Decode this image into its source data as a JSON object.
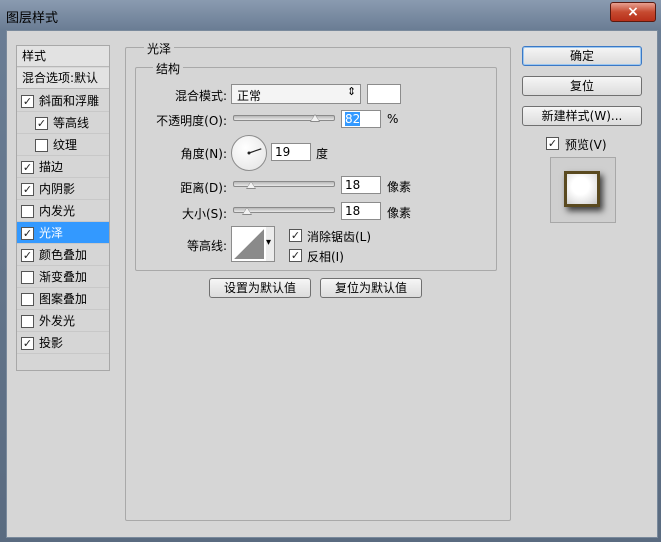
{
  "window": {
    "title": "图层样式",
    "close_glyph": "×"
  },
  "left_panel": {
    "header_styles": "样式",
    "header_blend": "混合选项:默认",
    "items": [
      {
        "label": "斜面和浮雕",
        "checked": true
      },
      {
        "label": "等高线",
        "checked": true
      },
      {
        "label": "纹理",
        "checked": false
      },
      {
        "label": "描边",
        "checked": true
      },
      {
        "label": "内阴影",
        "checked": true
      },
      {
        "label": "内发光",
        "checked": false
      },
      {
        "label": "光泽",
        "checked": true,
        "selected": true
      },
      {
        "label": "颜色叠加",
        "checked": true
      },
      {
        "label": "渐变叠加",
        "checked": false
      },
      {
        "label": "图案叠加",
        "checked": false
      },
      {
        "label": "外发光",
        "checked": false
      },
      {
        "label": "投影",
        "checked": true
      }
    ]
  },
  "main": {
    "section_title": "光泽",
    "group_title": "结构",
    "blend_mode_label": "混合模式:",
    "blend_mode_value": "正常",
    "blend_color": "#ffffff",
    "opacity_label": "不透明度(O):",
    "opacity_value": "82",
    "opacity_unit": "%",
    "angle_label": "角度(N):",
    "angle_value": "19",
    "angle_unit": "度",
    "distance_label": "距离(D):",
    "distance_value": "18",
    "distance_unit": "像素",
    "size_label": "大小(S):",
    "size_value": "18",
    "size_unit": "像素",
    "contour_label": "等高线:",
    "antialias_label": "消除锯齿(L)",
    "antialias_checked": true,
    "invert_label": "反相(I)",
    "invert_checked": true,
    "set_default_button": "设置为默认值",
    "reset_default_button": "复位为默认值"
  },
  "right_panel": {
    "ok_button": "确定",
    "reset_button": "复位",
    "new_style_button": "新建样式(W)...",
    "preview_label": "预览(V)",
    "preview_checked": true
  },
  "colors": {
    "selection": "#3399ff",
    "dialog_bg": "#d6d6d6"
  },
  "icons": {
    "checkmark": "✓",
    "dropdown": "▾"
  }
}
